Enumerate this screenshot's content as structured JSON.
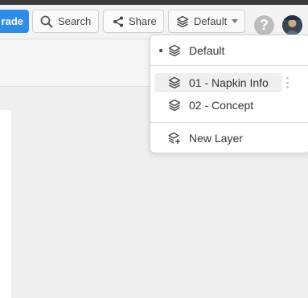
{
  "toolbar": {
    "upgrade_label": "rade",
    "search_label": "Search",
    "share_label": "Share",
    "layer_label": "Default",
    "help_label": "?"
  },
  "icons": {
    "search": "search-icon",
    "share": "share-icon",
    "layers": "layers-icon",
    "help": "help-icon",
    "avatar": "avatar"
  },
  "layer_menu": {
    "items": [
      {
        "label": "Default",
        "active": true
      },
      {
        "label": "01 - Napkin Info",
        "highlighted": true
      },
      {
        "label": "02 - Concept"
      }
    ],
    "new_layer_label": "New Layer"
  },
  "colors": {
    "accent": "#2f8be6",
    "toolbar_bg": "#f3f3f3",
    "canvas_bg": "#efefef",
    "help_bg": "#bdbdbd"
  }
}
